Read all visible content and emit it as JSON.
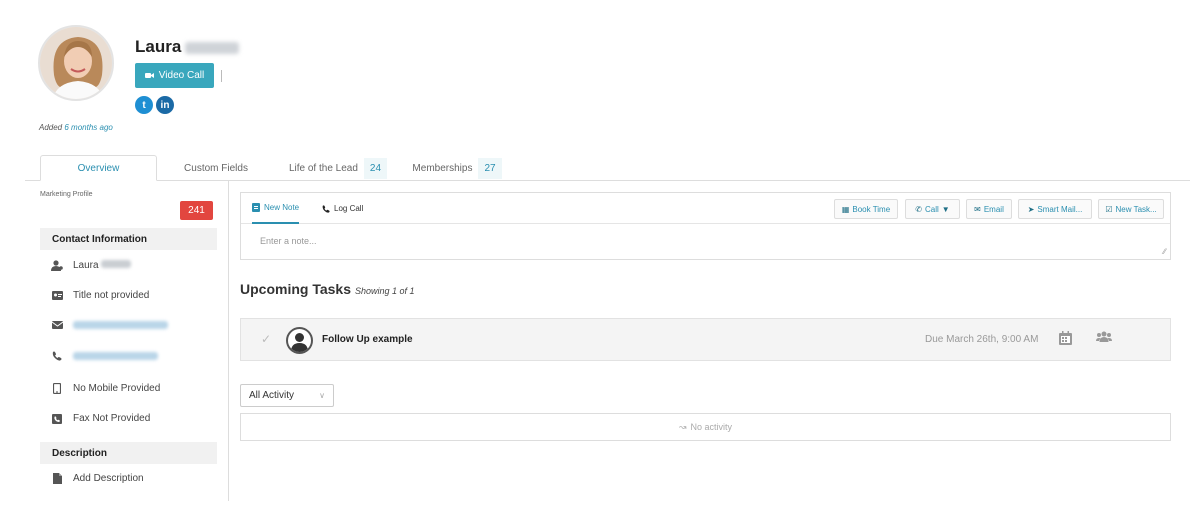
{
  "contact": {
    "first_name": "Laura",
    "added_prefix": "Added",
    "added_relative": "6 months ago"
  },
  "header": {
    "video_call_label": "Video Call",
    "social": [
      {
        "icon": "twitter-icon",
        "glyph": "t"
      },
      {
        "icon": "linkedin-icon",
        "glyph": "in"
      }
    ]
  },
  "tabs": [
    {
      "label": "Overview",
      "count": "",
      "active": true
    },
    {
      "label": "Custom Fields",
      "count": "",
      "active": false
    },
    {
      "label": "Life of the Lead",
      "count": "24",
      "active": false
    },
    {
      "label": "Memberships",
      "count": "27",
      "active": false
    }
  ],
  "sidebar": {
    "marketing_profile_label": "Marketing Profile",
    "marketing_score": "241",
    "contact_info_heading": "Contact Information",
    "contact_rows": [
      {
        "icon": "user-icon",
        "text": "Laura"
      },
      {
        "icon": "id-card-icon",
        "text": "Title not provided"
      },
      {
        "icon": "envelope-icon",
        "text": ""
      },
      {
        "icon": "phone-icon",
        "text": ""
      },
      {
        "icon": "mobile-icon",
        "text": "No Mobile Provided"
      },
      {
        "icon": "fax-icon",
        "text": "Fax Not Provided"
      }
    ],
    "description_heading": "Description",
    "add_description_label": "Add Description"
  },
  "composer": {
    "new_note_label": "New Note",
    "log_call_label": "Log Call",
    "note_placeholder": "Enter a note...",
    "actions": [
      {
        "icon": "calendar-icon",
        "label": "Book Time"
      },
      {
        "icon": "phone-call-icon",
        "label": "Call"
      },
      {
        "icon": "email-icon",
        "label": "Email"
      },
      {
        "icon": "send-icon",
        "label": "Smart Mail..."
      },
      {
        "icon": "task-icon",
        "label": "New Task..."
      }
    ]
  },
  "upcoming_tasks": {
    "title": "Upcoming Tasks",
    "showing": "Showing 1 of 1",
    "items": [
      {
        "name": "Follow Up example",
        "due": "Due March 26th, 9:00 AM"
      }
    ]
  },
  "activity": {
    "filter_value": "All Activity",
    "empty_text": "No activity"
  },
  "colors": {
    "accent": "#39a7bd",
    "badge": "#e2463f",
    "link": "#2a8fb0"
  }
}
